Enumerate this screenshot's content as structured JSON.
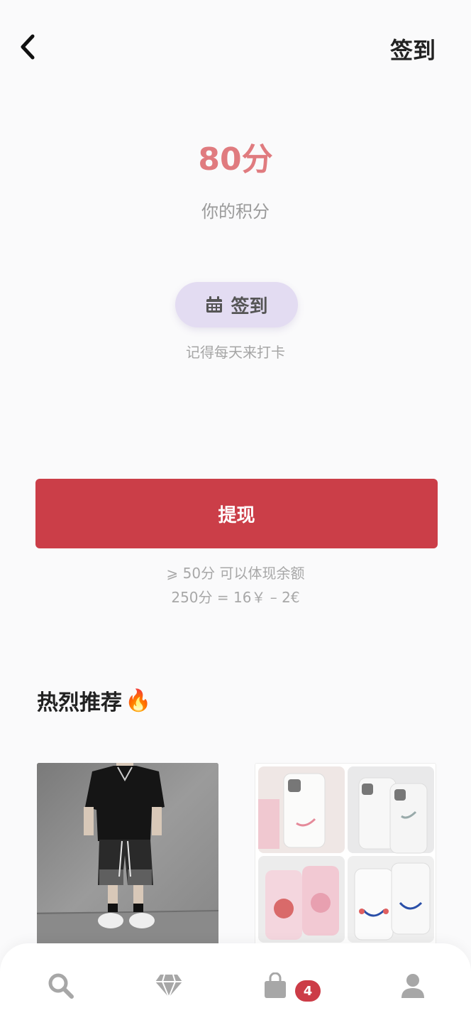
{
  "header": {
    "title": "签到"
  },
  "points": {
    "value": "80分",
    "label": "你的积分"
  },
  "checkin": {
    "button_label": "签到",
    "hint": "记得每天来打卡"
  },
  "withdraw": {
    "button_label": "提现",
    "note_line1": "⩾ 50分 可以体现余额",
    "note_line2": "250分 = 16￥ – 2€"
  },
  "recommend": {
    "title": "热烈推荐",
    "title_emoji": "🔥",
    "items": [
      {
        "name": "product-black-tshirt-shorts"
      },
      {
        "name": "product-phone-cases"
      }
    ]
  },
  "bottom_nav": {
    "items": [
      "search-icon",
      "diamond-icon",
      "bag-icon",
      "user-icon"
    ],
    "cart_badge": "4"
  },
  "colors": {
    "accent_red": "#cb3e48",
    "points_pink": "#e07b7f",
    "checkin_lavender": "#e3dcf2"
  }
}
